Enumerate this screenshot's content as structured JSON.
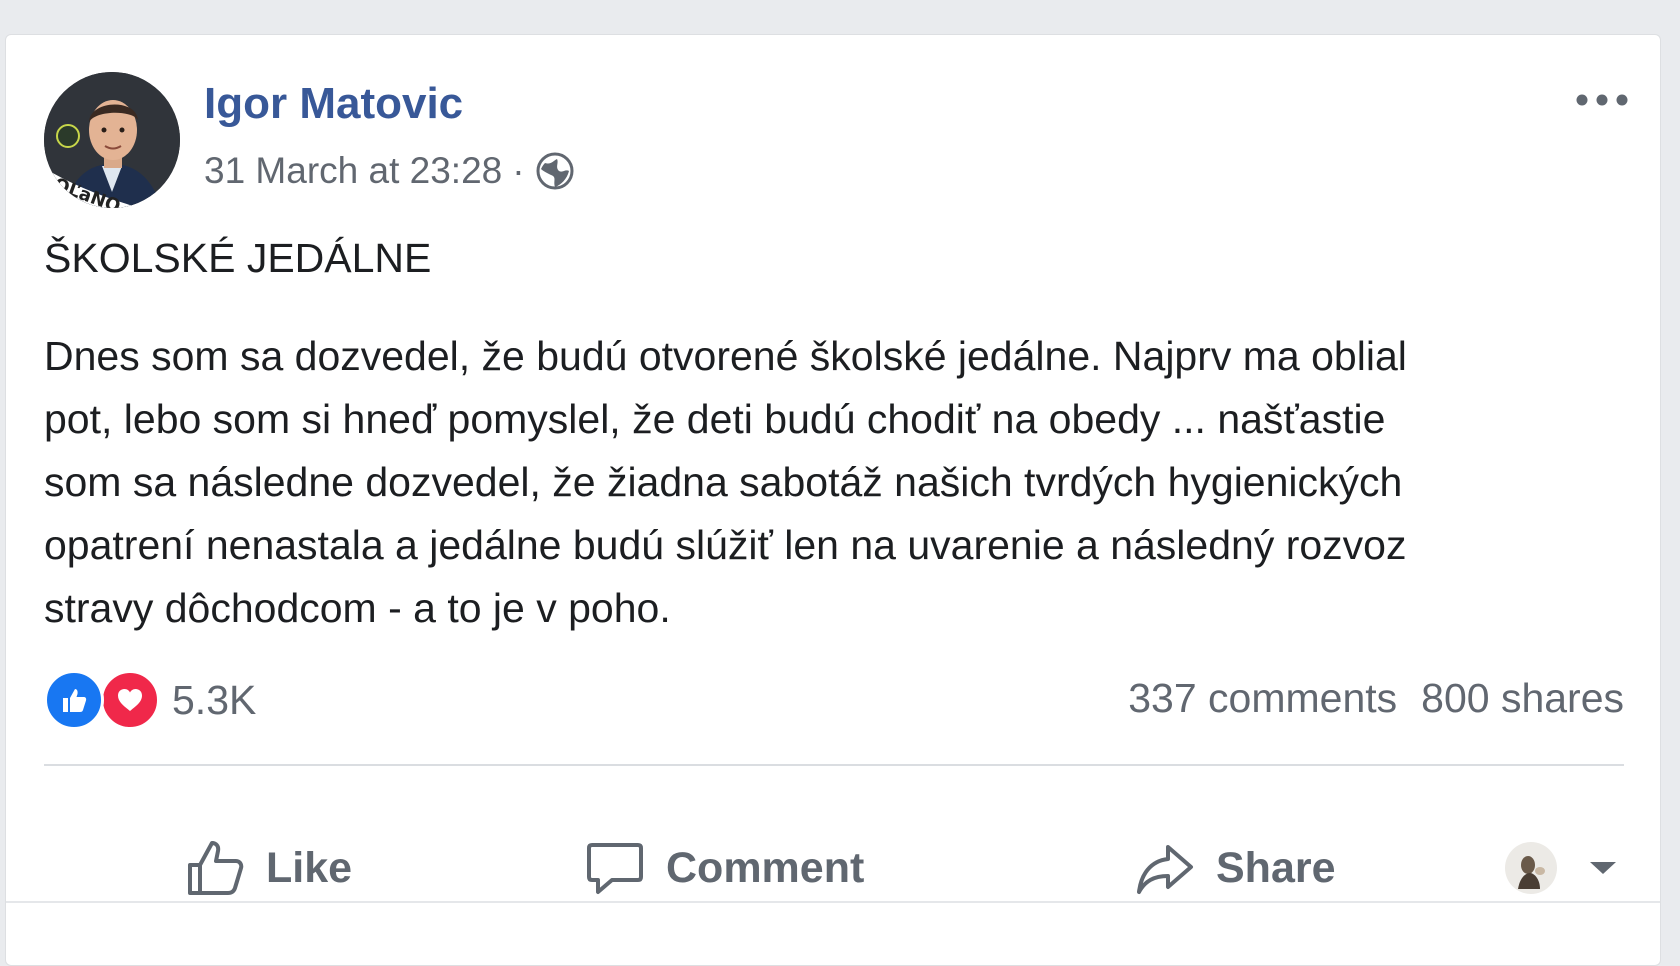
{
  "post": {
    "author": "Igor Matovic",
    "timestamp": "31 March at 23:28",
    "separator": "·",
    "privacy_icon": "globe-icon",
    "avatar_badge": "OĽaNO",
    "title": "ŠKOLSKÉ JEDÁLNE",
    "body_lines": [
      "Dnes som sa dozvedel, že budú otvorené školské jedálne. Najprv ma oblial",
      "pot, lebo som si hneď pomyslel, že deti budú chodiť na obedy ... našťastie",
      "som sa následne dozvedel, že žiadna sabotáž našich tvrdých hygienických",
      "opatrení nenastala a jedálne budú slúžiť len na uvarenie a následný rozvoz",
      "stravy dôchodcom - a to je v poho."
    ]
  },
  "stats": {
    "reaction_count": "5.3K",
    "comments": "337 comments",
    "shares": "800 shares"
  },
  "actions": {
    "like": "Like",
    "comment": "Comment",
    "share": "Share"
  },
  "colors": {
    "author": "#385898",
    "like_blue": "#1877f2",
    "love_red": "#f0284a",
    "secondary_text": "#606770"
  }
}
